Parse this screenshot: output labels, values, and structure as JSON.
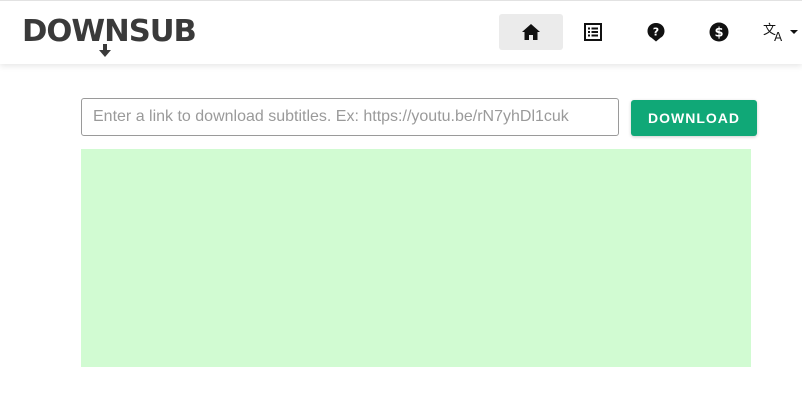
{
  "brand": {
    "logo_text": "DOWNSUB"
  },
  "nav": {
    "items": [
      {
        "icon": "home-icon",
        "active": true
      },
      {
        "icon": "list-icon",
        "active": false
      },
      {
        "icon": "help-icon",
        "active": false
      },
      {
        "icon": "dollar-icon",
        "active": false
      },
      {
        "icon": "translate-icon",
        "active": false
      }
    ]
  },
  "search": {
    "value": "",
    "placeholder": "Enter a link to download subtitles. Ex: https://youtu.be/rN7yhDl1cuk"
  },
  "actions": {
    "download_label": "DOWNLOAD"
  },
  "colors": {
    "accent": "#10a877",
    "ad_background": "#d1fbd2",
    "text_dark": "#3a3a3a"
  }
}
